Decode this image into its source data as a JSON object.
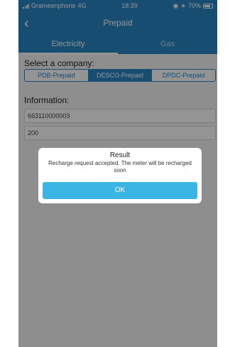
{
  "status_bar": {
    "carrier": "Grameenphone",
    "network": "4G",
    "time": "18:39",
    "battery": "70%"
  },
  "nav": {
    "title": "Prepaid"
  },
  "tabs": [
    {
      "label": "Electricity"
    },
    {
      "label": "Gas"
    }
  ],
  "form": {
    "company_label": "Select a company:",
    "companies": [
      {
        "label": "PDB-Prepaid"
      },
      {
        "label": "DESCO-Prepaid"
      },
      {
        "label": "DPDC-Prepaid"
      }
    ],
    "selected_company": "DESCO-Prepaid",
    "info_label": "Information:",
    "meter_value": "663110000003",
    "amount_value": "200"
  },
  "dialog": {
    "title": "Result",
    "message": "Recharge request accepted. The meter will be recharged soon",
    "ok_label": "OK"
  },
  "colors": {
    "primary": "#2a86c4",
    "button": "#3ab5e4"
  }
}
